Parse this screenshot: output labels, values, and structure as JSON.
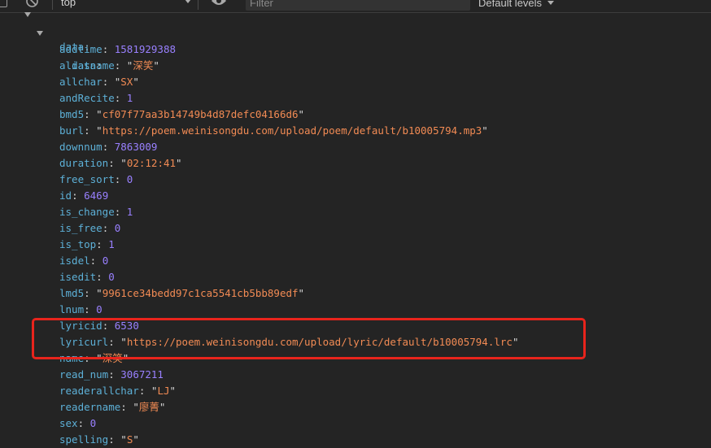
{
  "toolbar": {
    "context": "top",
    "filter_placeholder": "Filter",
    "levels": "Default levels"
  },
  "tree": {
    "parent_key": "data",
    "child_key": "data",
    "entries": [
      {
        "key": "addtime",
        "value": "1581929388",
        "type": "number"
      },
      {
        "key": "aliasname",
        "value": "深笑",
        "type": "string"
      },
      {
        "key": "allchar",
        "value": "SX",
        "type": "string"
      },
      {
        "key": "andRecite",
        "value": "1",
        "type": "number"
      },
      {
        "key": "bmd5",
        "value": "cf07f77aa3b14749b4d87defc04166d6",
        "type": "string"
      },
      {
        "key": "burl",
        "value": "https://poem.weinisongdu.com/upload/poem/default/b10005794.mp3",
        "type": "string"
      },
      {
        "key": "downnum",
        "value": "7863009",
        "type": "number"
      },
      {
        "key": "duration",
        "value": "02:12:41",
        "type": "string"
      },
      {
        "key": "free_sort",
        "value": "0",
        "type": "number"
      },
      {
        "key": "id",
        "value": "6469",
        "type": "number"
      },
      {
        "key": "is_change",
        "value": "1",
        "type": "number"
      },
      {
        "key": "is_free",
        "value": "0",
        "type": "number"
      },
      {
        "key": "is_top",
        "value": "1",
        "type": "number"
      },
      {
        "key": "isdel",
        "value": "0",
        "type": "number"
      },
      {
        "key": "isedit",
        "value": "0",
        "type": "number"
      },
      {
        "key": "lmd5",
        "value": "9961ce34bedd97c1ca5541cb5bb89edf",
        "type": "string"
      },
      {
        "key": "lnum",
        "value": "0",
        "type": "number"
      },
      {
        "key": "lyricid",
        "value": "6530",
        "type": "number"
      },
      {
        "key": "lyricurl",
        "value": "https://poem.weinisongdu.com/upload/lyric/default/b10005794.lrc",
        "type": "string"
      },
      {
        "key": "name",
        "value": "深笑",
        "type": "string"
      },
      {
        "key": "read_num",
        "value": "3067211",
        "type": "number"
      },
      {
        "key": "readerallchar",
        "value": "LJ",
        "type": "string"
      },
      {
        "key": "readername",
        "value": "廖菁",
        "type": "string"
      },
      {
        "key": "sex",
        "value": "0",
        "type": "number"
      },
      {
        "key": "spelling",
        "value": "S",
        "type": "string"
      }
    ]
  },
  "colors": {
    "background": "#242424",
    "key": "#5db0d7",
    "number": "#9980ff",
    "string": "#f28b54",
    "highlight": "#e8241c"
  }
}
